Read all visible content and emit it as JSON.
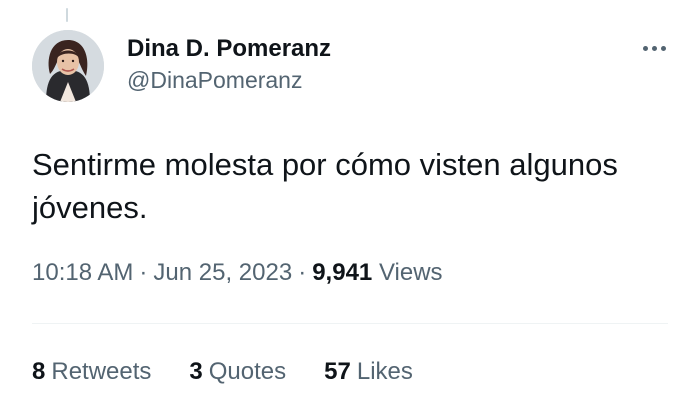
{
  "tweet": {
    "author": {
      "display_name": "Dina D. Pomeranz",
      "handle": "@DinaPomeranz"
    },
    "text": "Sentirme molesta por cómo visten algunos jóvenes.",
    "time": "10:18 AM",
    "date": "Jun 25, 2023",
    "separator": "·",
    "views_count": "9,941",
    "views_label": "Views",
    "more_icon": "ellipsis-icon"
  },
  "stats": [
    {
      "count": "8",
      "label": "Retweets"
    },
    {
      "count": "3",
      "label": "Quotes"
    },
    {
      "count": "57",
      "label": "Likes"
    }
  ],
  "colors": {
    "text_primary": "#0f1419",
    "text_secondary": "#536471",
    "divider": "#eff3f4"
  }
}
